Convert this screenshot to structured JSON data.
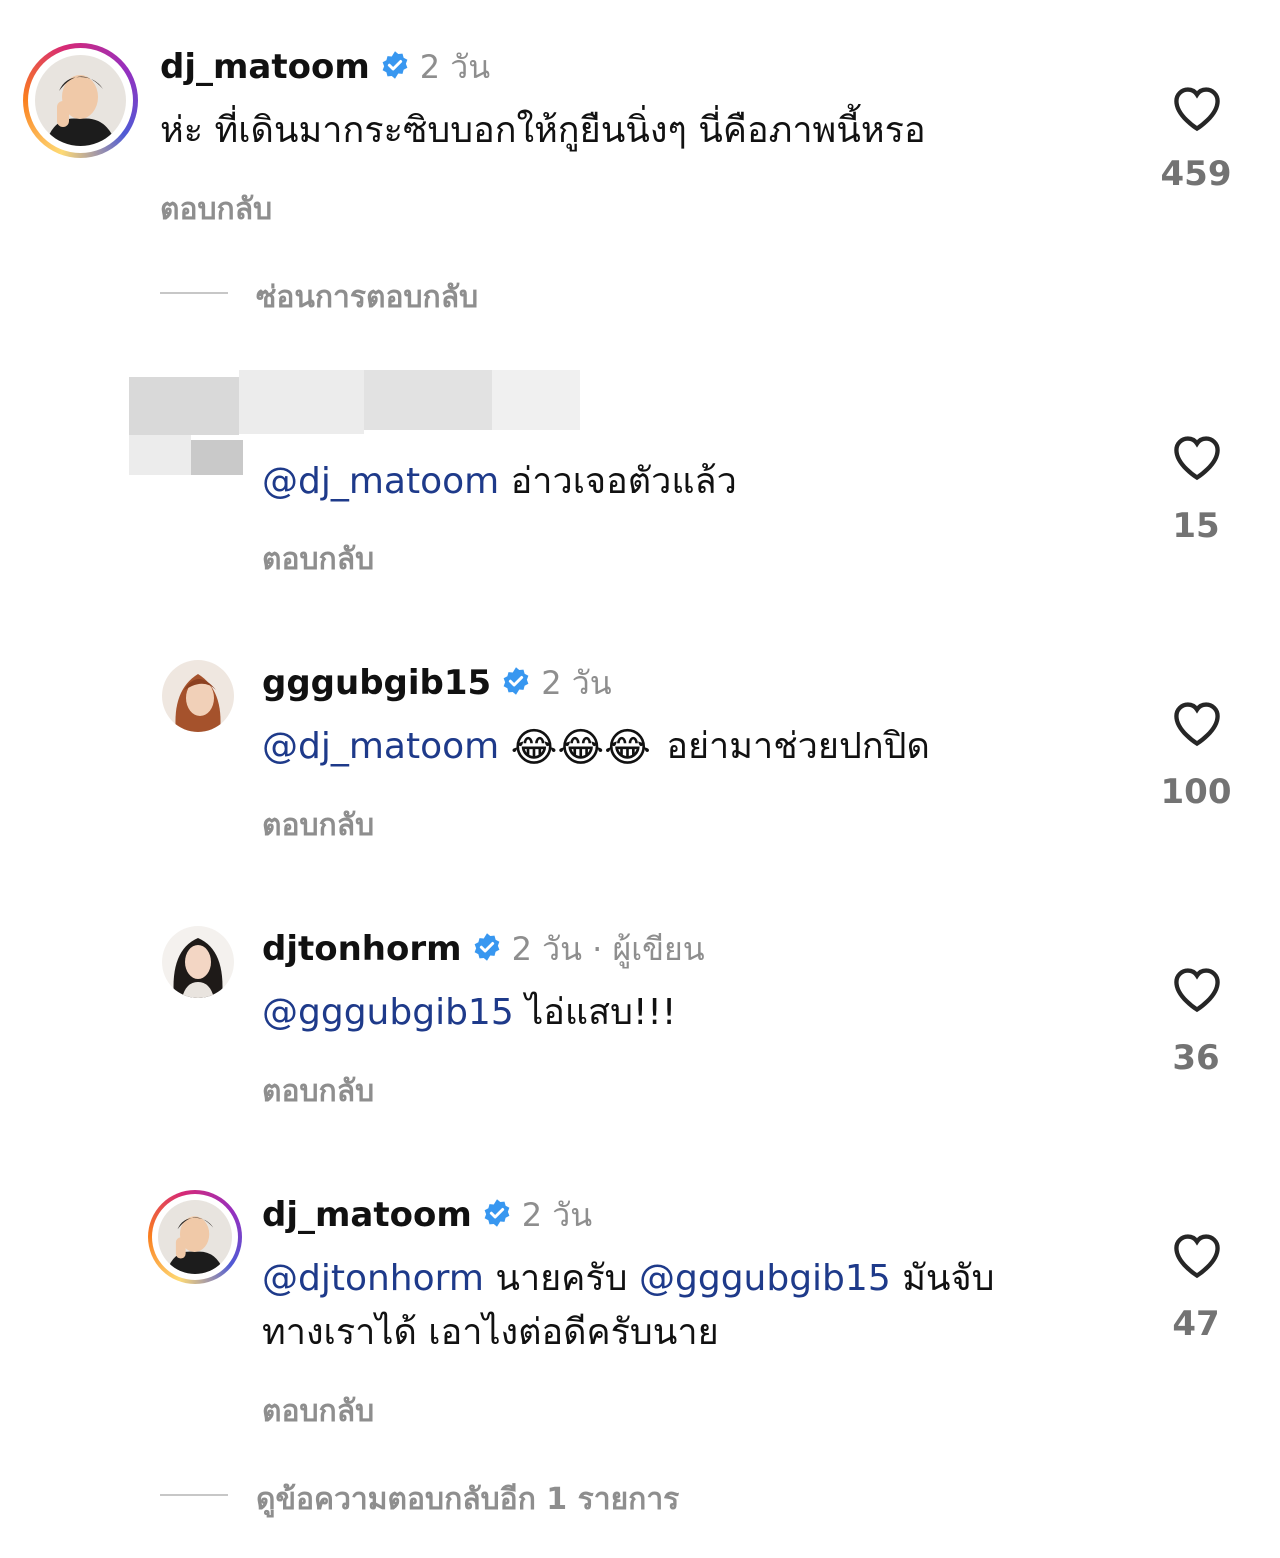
{
  "colors": {
    "mention": "#1e3a8a",
    "verified": "#3897f0",
    "muted": "#8e8e8e"
  },
  "comments": [
    {
      "username": "dj_matoom",
      "time": "2 วัน",
      "text": "ห่ะ ที่เดินมากระซิบบอกให้กูยืนนิ่งๆ นี่คือภาพนี้หรอ",
      "reply_label": "ตอบกลับ",
      "likes": "459"
    },
    {
      "mention": "@dj_matoom",
      "text": "อ่าวเจอตัวแล้ว",
      "reply_label": "ตอบกลับ",
      "likes": "15"
    },
    {
      "username": "gggubgib15",
      "time": "2 วัน",
      "mention": "@dj_matoom",
      "emoji": "😂😂😂",
      "text": "อย่ามาช่วยปกปิด",
      "reply_label": "ตอบกลับ",
      "likes": "100"
    },
    {
      "username": "djtonhorm",
      "time": "2 วัน · ผู้เขียน",
      "mention": "@gggubgib15",
      "text": "ไอ่แสบ!!!",
      "reply_label": "ตอบกลับ",
      "likes": "36"
    },
    {
      "username": "dj_matoom",
      "time": "2 วัน",
      "mention1": "@djtonhorm",
      "text1": "นายครับ",
      "mention2": "@gggubgib15",
      "text2": "มันจับ",
      "line2": "ทางเราได้ เอาไงต่อดีครับนาย",
      "reply_label": "ตอบกลับ",
      "likes": "47"
    }
  ],
  "hide_replies_label": "ซ่อนการตอบกลับ",
  "view_more_replies_label": "ดูข้อความตอบกลับอีก 1 รายการ"
}
